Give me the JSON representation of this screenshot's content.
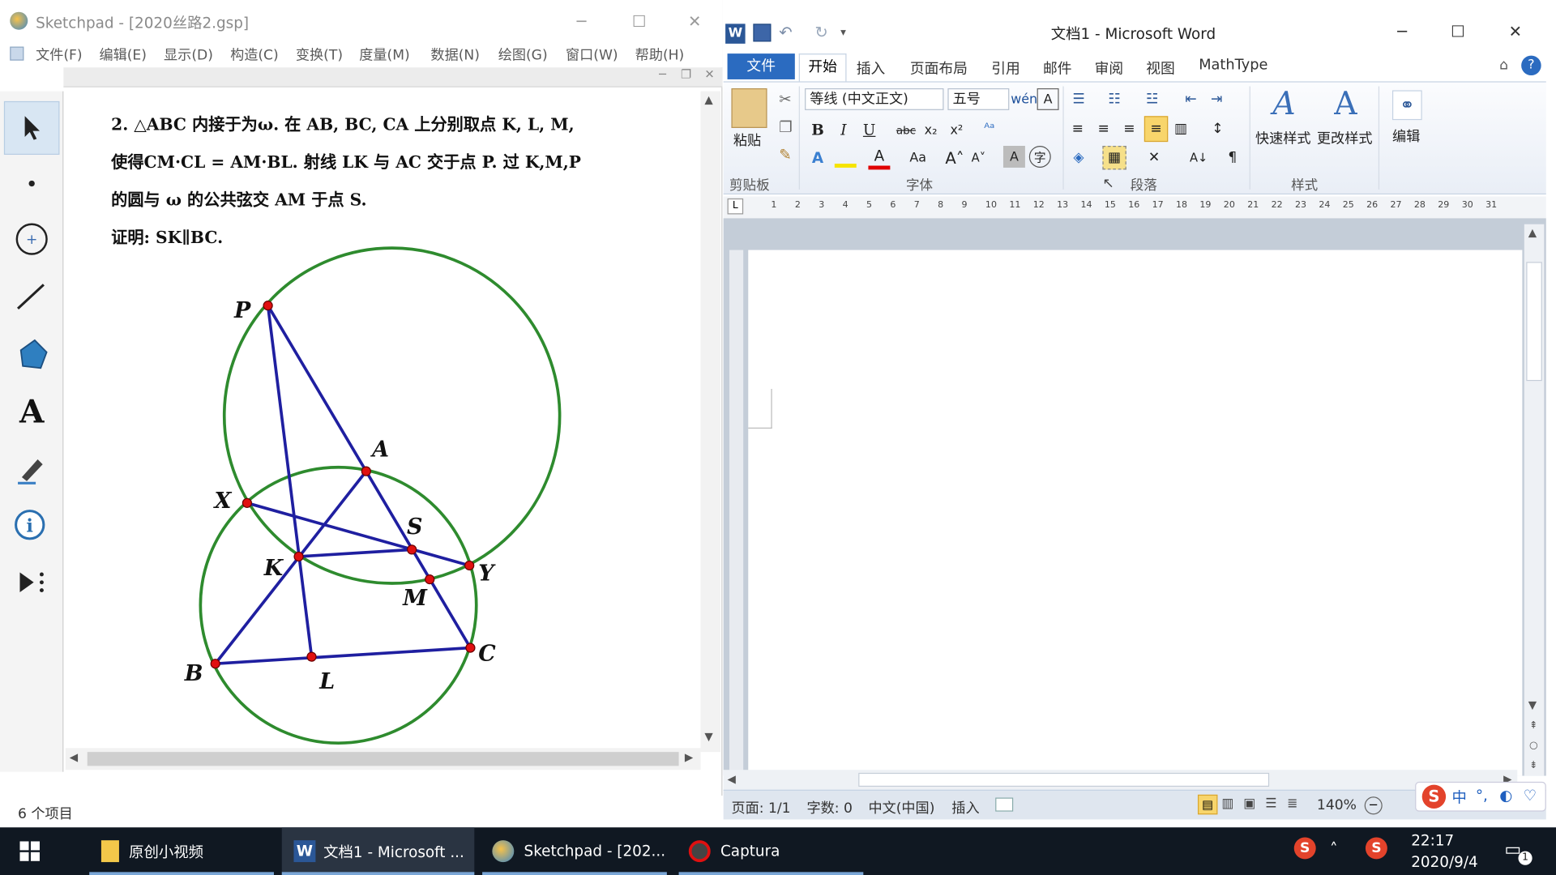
{
  "sketchpad": {
    "title": "Sketchpad  - [2020丝路2.gsp]",
    "menu": [
      "文件(F)",
      "编辑(E)",
      "显示(D)",
      "构造(C)",
      "变换(T)",
      "度量(M)",
      "数据(N)",
      "绘图(G)",
      "窗口(W)",
      "帮助(H)"
    ],
    "problem_lines": [
      "2. △ABC 内接于为ω. 在 AB, BC, CA 上分别取点 K, L, M,",
      "使得CM·CL = AM·BL. 射线 LK 与 AC 交于点 P. 过 K,M,P",
      "的圆与 ω 的公共弦交 AM 于点 S.",
      "证明: SK∥BC."
    ],
    "point_labels": {
      "P": "P",
      "A": "A",
      "X": "X",
      "S": "S",
      "K": "K",
      "Y": "Y",
      "M": "M",
      "B": "B",
      "C": "C",
      "L": "L"
    },
    "status_items": "6 个项目",
    "accent_green": "#2e8b2e",
    "accent_blue": "#1f1fa0",
    "point_red": "#e01010"
  },
  "word": {
    "title": "文档1 - Microsoft Word",
    "tabs": [
      "文件",
      "开始",
      "插入",
      "页面布局",
      "引用",
      "邮件",
      "审阅",
      "视图",
      "MathType"
    ],
    "font_name": "等线 (中文正文)",
    "font_size": "五号",
    "paste_label": "粘贴",
    "quick_styles": "快速样式",
    "change_styles": "更改样式",
    "edit_label": "编辑",
    "groups": [
      "剪贴板",
      "字体",
      "段落",
      "样式"
    ],
    "status": {
      "page": "页面: 1/1",
      "words": "字数: 0",
      "lang": "中文(中国)",
      "mode": "插入",
      "zoom": "140%"
    },
    "ruler_ticks": [
      "1",
      "2",
      "3",
      "4",
      "5",
      "6",
      "7",
      "8",
      "9",
      "10",
      "11",
      "12",
      "13",
      "14",
      "15",
      "16",
      "17",
      "18",
      "19",
      "20",
      "21",
      "22",
      "23",
      "24",
      "25",
      "26",
      "27",
      "28",
      "29",
      "30",
      "31"
    ],
    "accent_blue": "#2b6bc0"
  },
  "taskbar": {
    "items": [
      "原创小视频",
      "文档1 - Microsoft ...",
      "Sketchpad  - [202...",
      "Captura"
    ],
    "time": "22:17",
    "date": "2020/9/4",
    "notification_count": "1"
  }
}
